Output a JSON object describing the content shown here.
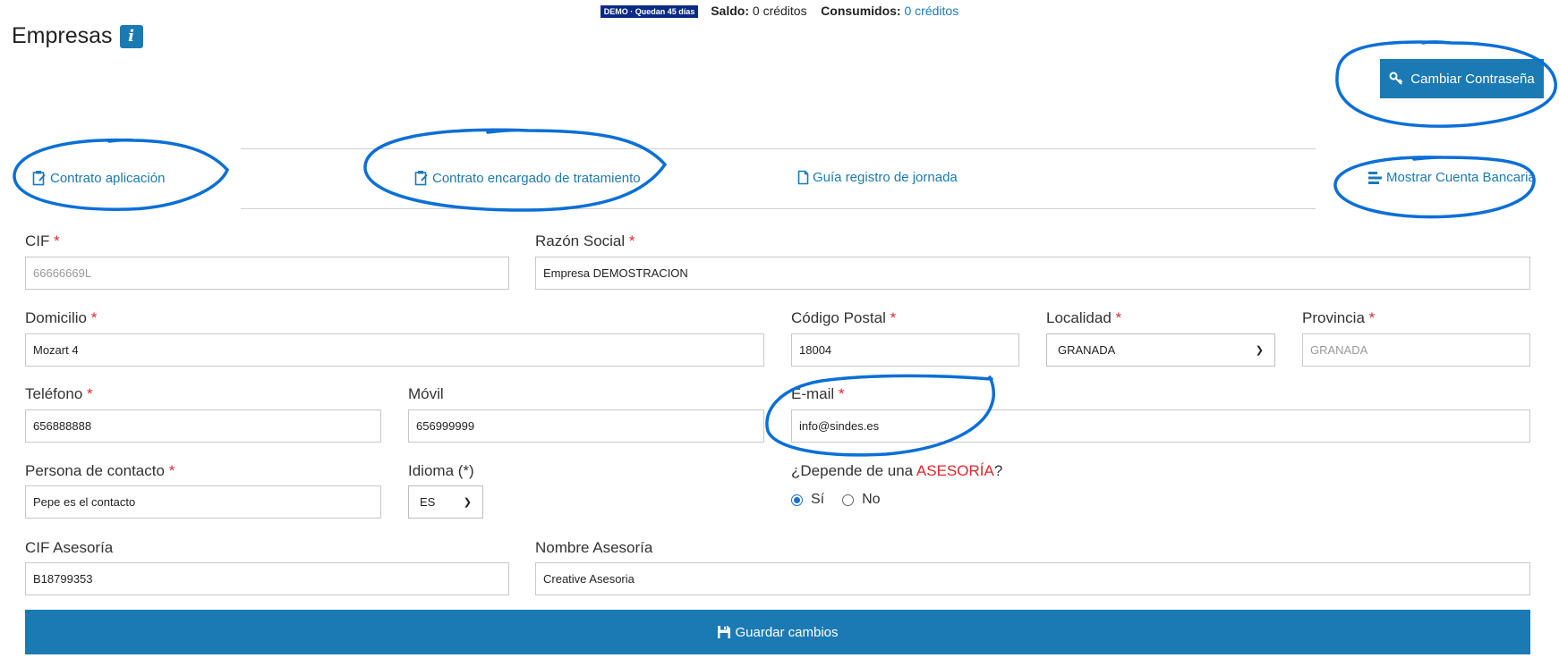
{
  "topbar": {
    "demo_badge": "DEMO  · Quedan 45 días",
    "saldo_label": "Saldo:",
    "saldo_value": "0 créditos",
    "consumidos_label": "Consumidos:",
    "consumidos_value": "0 créditos"
  },
  "page": {
    "title": "Empresas",
    "info_icon_text": "i"
  },
  "buttons": {
    "change_password": "Cambiar Contraseña",
    "save": "Guardar cambios"
  },
  "doc_links": [
    {
      "label": "Contrato aplicación",
      "icon": "clipboard-edit-icon"
    },
    {
      "label": "Contrato encargado de tratamiento",
      "icon": "clipboard-edit-icon"
    },
    {
      "label": "Guía registro de jornada",
      "icon": "document-icon"
    },
    {
      "label": "Mostrar Cuenta Bancaria",
      "icon": "align-left-icon"
    }
  ],
  "form": {
    "cif": {
      "label": "CIF",
      "required": "*",
      "value": "66666669L"
    },
    "razon_social": {
      "label": "Razón Social",
      "required": "*",
      "value": "Empresa DEMOSTRACION"
    },
    "domicilio": {
      "label": "Domicilio",
      "required": "*",
      "value": "Mozart 4"
    },
    "codigo_postal": {
      "label": "Código Postal",
      "required": "*",
      "value": "18004"
    },
    "localidad": {
      "label": "Localidad",
      "required": "*",
      "value": "GRANADA"
    },
    "provincia": {
      "label": "Provincia",
      "required": "*",
      "value": "GRANADA"
    },
    "telefono": {
      "label": "Teléfono",
      "required": "*",
      "value": "656888888"
    },
    "movil": {
      "label": "Móvil",
      "value": "656999999"
    },
    "email": {
      "label": "E-mail",
      "required": "*",
      "value": "info@sindes.es"
    },
    "persona_contacto": {
      "label": "Persona de contacto",
      "required": "*",
      "value": "Pepe es el contacto"
    },
    "idioma": {
      "label": "Idioma (*)",
      "value": "ES"
    },
    "depende_asesoria": {
      "label_prefix": "¿Depende de una ",
      "label_highlight": "ASESORÍA",
      "label_suffix": "?",
      "options": [
        "Sí",
        "No"
      ],
      "selected": "Sí"
    },
    "cif_asesoria": {
      "label": "CIF Asesoría",
      "value": "B18799353"
    },
    "nombre_asesoria": {
      "label": "Nombre Asesoría",
      "value": "Creative Asesoria"
    }
  },
  "colors": {
    "accent": "#1b7ab3",
    "required": "#e0262c",
    "annotation": "#0a6fd6"
  }
}
